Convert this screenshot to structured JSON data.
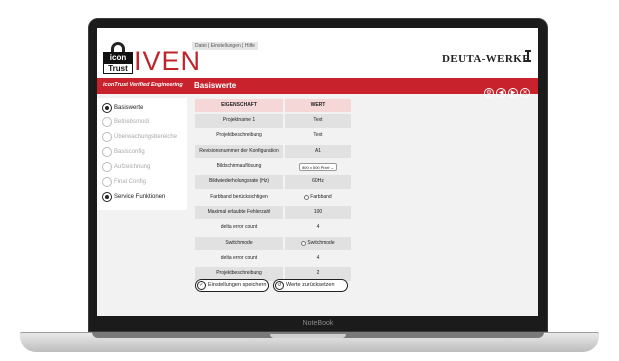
{
  "header": {
    "top_menu": "Datei | Einstellungen | Hilfe",
    "logo_icon_text": "icon",
    "logo_trust_text": "Trust",
    "logo_product": "IVEN",
    "tagline": "iconTrust Verified Engineering",
    "manufacturer": "DEUTA-WERKE",
    "section_title": "Basiswerte",
    "nav_icons": [
      "settings-icon",
      "back-icon",
      "forward-icon",
      "close-icon"
    ]
  },
  "sidebar": {
    "items": [
      {
        "label": "Basiswerte",
        "active": true
      },
      {
        "label": "Betriebsmodi",
        "active": false
      },
      {
        "label": "Überwachungsbereiche",
        "active": false
      },
      {
        "label": "Basisconfig",
        "active": false
      },
      {
        "label": "Aufzeichnung",
        "active": false
      },
      {
        "label": "Final Config",
        "active": false
      },
      {
        "label": "Service Funktionen",
        "active": true
      }
    ]
  },
  "table": {
    "header": {
      "key": "EIGENSCHAFT",
      "value": "WERT"
    },
    "rows": [
      {
        "key": "Projektname 1",
        "value": "Text"
      },
      {
        "key": "Projektbeschreibung",
        "value": "Text"
      },
      {
        "key": "Revisionsnummer der Konfiguration",
        "value": "A1"
      },
      {
        "key": "Bildschirmauflösung",
        "value": "800 x 600 Pixel"
      },
      {
        "key": "Bildwiederholungsrate (Hz)",
        "value": "60Hz"
      },
      {
        "key": "Farbband berücksichtigen",
        "value": "Farbband"
      },
      {
        "key": "Maximal erlaubte Fehlerzahl",
        "value": "100"
      },
      {
        "key": "delta error count",
        "value": "4"
      },
      {
        "key": "Switchmode",
        "value": "Switchmode"
      },
      {
        "key": "delta error count",
        "value": "4"
      },
      {
        "key": "Projektbeschreibung",
        "value": "2"
      }
    ]
  },
  "buttons": {
    "save": "Einstellungen speichern",
    "reset": "Werte zurücksetzen"
  },
  "device": {
    "label": "NoteBook"
  },
  "colors": {
    "accent": "#c8232c",
    "header_row": "#f6d7d8",
    "row_shade": "#e1e1e1"
  }
}
